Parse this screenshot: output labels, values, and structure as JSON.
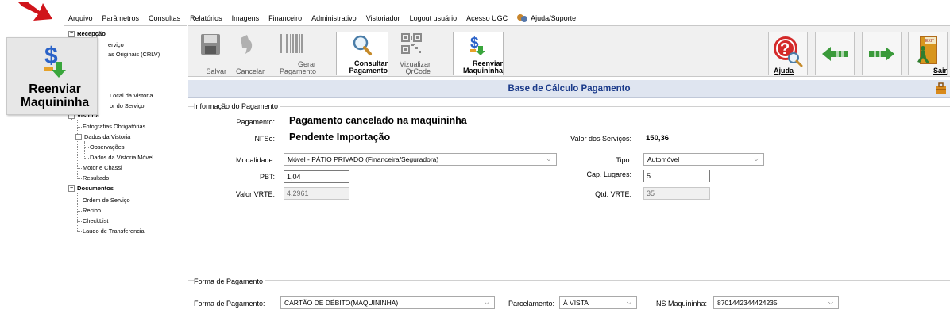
{
  "menu": [
    "Arquivo",
    "Parâmetros",
    "Consultas",
    "Relatórios",
    "Imagens",
    "Financeiro",
    "Administrativo",
    "Vistoriador",
    "Logout usuário",
    "Acesso UGC",
    "Ajuda/Suporte"
  ],
  "tree": {
    "recepcao_label": "Recepção",
    "recepcao_items": [
      "erviço",
      "as Originais (CRLV)"
    ],
    "local_items": [
      "Local da Vistoria",
      "or do Serviço"
    ],
    "vistoria_label": "Vistoria",
    "vistoria_items": [
      "Fotografias Obrigatórias",
      "Dados da Vistoria"
    ],
    "dados_children": [
      "Observações",
      "Dados da Vistoria Móvel"
    ],
    "vistoria_items2": [
      "Motor e Chassi",
      "Resultado"
    ],
    "documentos_label": "Documentos",
    "documentos_items": [
      "Ordem de Serviço",
      "Recibo",
      "CheckList",
      "Laudo de Transferencia"
    ]
  },
  "floating_button": {
    "label_line1": "Reenviar",
    "label_line2": "Maquininha"
  },
  "toolbar": {
    "salvar": "Salvar",
    "cancelar": "Cancelar",
    "gerar_1": "Gerar",
    "gerar_2": "Pagamento",
    "consultar_1": "Consultar",
    "consultar_2": "Pagamento",
    "qrcode_1": "Vizualizar",
    "qrcode_2": "QrCode",
    "reenviar_1": "Reenviar",
    "reenviar_2": "Maquininha",
    "ajuda": "Ajuda",
    "sair": "Sair"
  },
  "title": "Base de Cálculo Pagamento",
  "info": {
    "group_label": "Informação do Pagamento",
    "pagamento_label": "Pagamento:",
    "pagamento_value": "Pagamento cancelado na maquininha",
    "nfse_label": "NFSe:",
    "nfse_value": "Pendente Importação",
    "valor_servicos_label": "Valor dos Serviços:",
    "valor_servicos_value": "150,36",
    "modalidade_label": "Modalidade:",
    "modalidade_value": "Móvel - PÁTIO PRIVADO (Financeira/Seguradora)",
    "tipo_label": "Tipo:",
    "tipo_value": "Automóvel",
    "pbt_label": "PBT:",
    "pbt_value": "1,04",
    "cap_label": "Cap. Lugares:",
    "cap_value": "5",
    "vrte_label": "Valor VRTE:",
    "vrte_value": "4,2961",
    "qtd_label": "Qtd. VRTE:",
    "qtd_value": "35"
  },
  "forma": {
    "group_label": "Forma de Pagamento",
    "forma_label": "Forma de Pagamento:",
    "forma_value": "CARTÃO DE DÉBITO(MAQUININHA)",
    "parcelamento_label": "Parcelamento:",
    "parcelamento_value": "À VISTA",
    "ns_label": "NS Maquininha:",
    "ns_value": "8701442344424235"
  },
  "colors": {
    "title_text": "#1a3a8a",
    "title_bg": "#dfe5f0",
    "arrow": "#d0141a"
  }
}
